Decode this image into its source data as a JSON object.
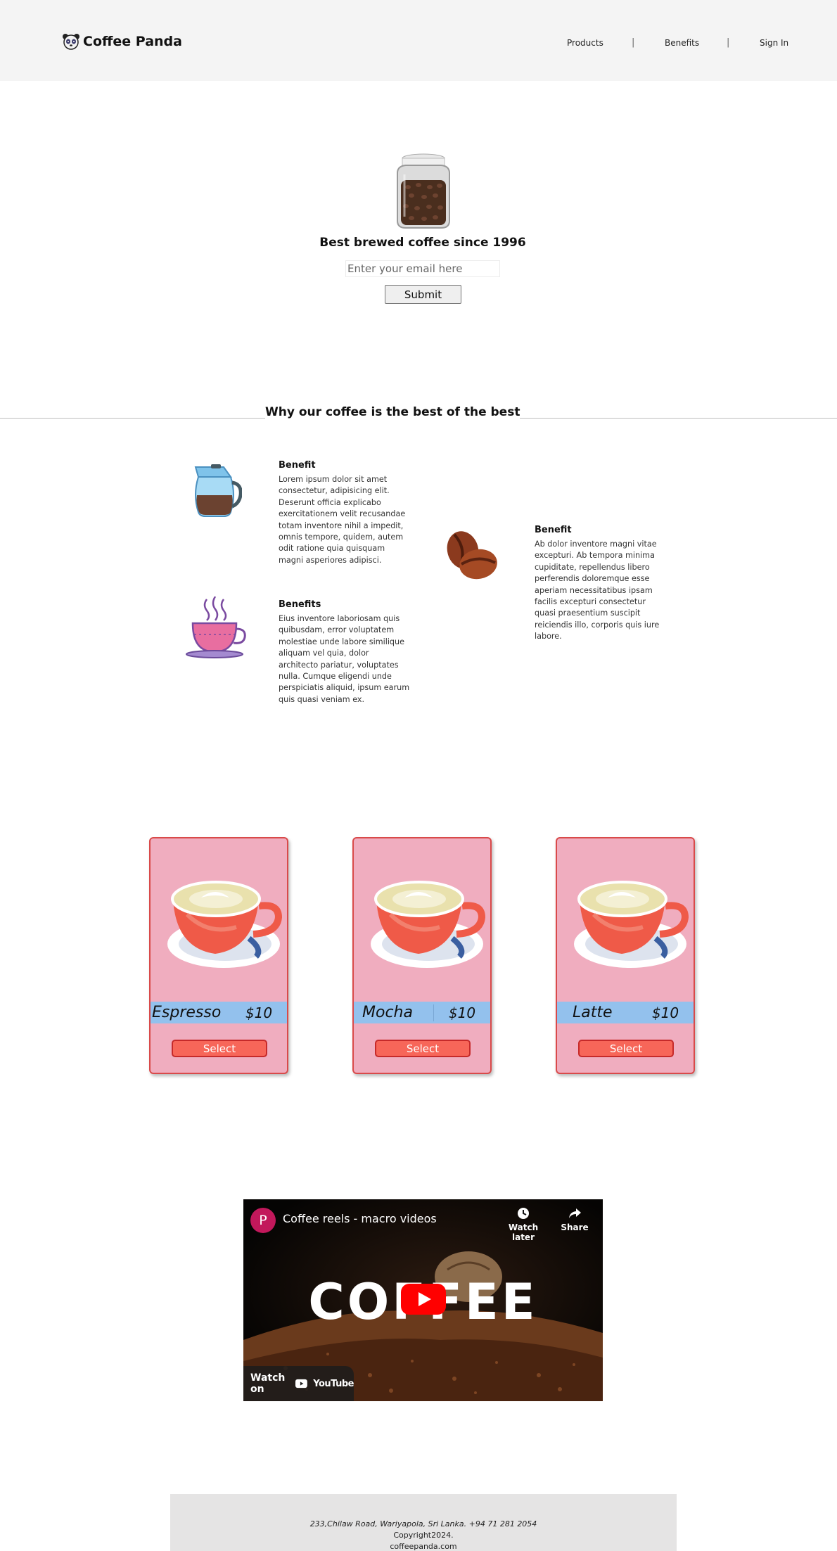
{
  "header": {
    "brand": "Coffee Panda",
    "logo_icon": "panda-icon",
    "nav": [
      "Products",
      "Benefits",
      "Sign In"
    ],
    "separator": "|"
  },
  "hero": {
    "image_icon": "coffee-jar-icon",
    "title": "Best brewed coffee since 1996",
    "email_placeholder": "Enter your email here",
    "submit_label": "Submit"
  },
  "benefits": {
    "heading": "Why our coffee is the best of the best",
    "items": [
      {
        "icon": "coffee-pot-icon",
        "title": "Benefit",
        "text": "Lorem ipsum dolor sit amet consectetur, adipisicing elit. Deserunt officia explicabo exercitationem velit recusandae totam inventore nihil a impedit, omnis tempore, quidem, autem odit ratione quia quisquam magni asperiores adipisci."
      },
      {
        "icon": "coffee-beans-icon",
        "title": "Benefit",
        "text": "Ab dolor inventore magni vitae excepturi. Ab tempora minima cupiditate, repellendus libero perferendis doloremque esse aperiam necessitatibus ipsam facilis excepturi consectetur quasi praesentium suscipit reiciendis illo, corporis quis iure labore."
      },
      {
        "icon": "tea-cup-icon",
        "title": "Benefits",
        "text": "Eius inventore laboriosam quis quibusdam, error voluptatem molestiae unde labore similique aliquam vel quia, dolor architecto pariatur, voluptates nulla. Cumque eligendi unde perspiciatis aliquid, ipsum earum quis quasi veniam ex."
      }
    ]
  },
  "products": [
    {
      "name": "Espresso",
      "price": "$10",
      "button": "Select",
      "image_icon": "latte-cup-icon"
    },
    {
      "name": "Mocha",
      "price": "$10",
      "button": "Select",
      "image_icon": "latte-cup-icon"
    },
    {
      "name": "Latte",
      "price": "$10",
      "button": "Select",
      "image_icon": "latte-cup-icon"
    }
  ],
  "video": {
    "channel_initial": "P",
    "title": "Coffee reels - macro videos",
    "watch_later": "Watch later",
    "share": "Share",
    "thumbnail_text": "COFFEE",
    "watch_on": "Watch on",
    "youtube": "YouTube",
    "colors": {
      "play": "#ff0000",
      "avatar": "#c2185b"
    }
  },
  "footer": {
    "address": "233,Chilaw Road, Wariyapola, Sri Lanka. +94 71 281 2054",
    "copyright": "Copyright2024.",
    "site": "coffeepanda.com"
  }
}
